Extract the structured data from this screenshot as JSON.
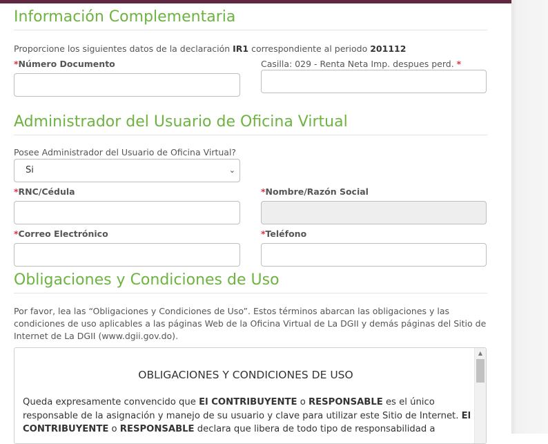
{
  "colors": {
    "accent": "#6cb33f",
    "top_bar": "#5f2742",
    "required": "#d9363e"
  },
  "section1": {
    "title": "Información Complementaria",
    "intro_prefix": "Proporcione los siguientes datos de la declaración ",
    "intro_form": "IR1",
    "intro_middle": " correspondiente al periodo ",
    "intro_period": "201112",
    "numero_documento_label": "Número Documento",
    "casilla_label": "Casilla: 029 - Renta Neta Imp. despues perd. ",
    "required_mark": "*",
    "numero_documento_value": "",
    "casilla_value": ""
  },
  "section2": {
    "title": "Administrador del Usuario de Oficina Virtual",
    "question": "Posee Administrador del Usuario de Oficina Virtual?",
    "select_value": "Si",
    "rnc_label": "RNC/Cédula",
    "nombre_label": "Nombre/Razón Social",
    "correo_label": "Correo Electrónico",
    "telefono_label": "Teléfono",
    "rnc_value": "",
    "nombre_value": "",
    "correo_value": "",
    "telefono_value": ""
  },
  "section3": {
    "title": "Obligaciones y Condiciones de Uso",
    "intro": "Por favor, lea las “Obligaciones y Condiciones de Uso”. Estos términos abarcan las obligaciones y las condiciones de uso aplicables a las páginas Web de la Oficina Virtual de La DGII y demás páginas del Sitio de Internet de La DGII (www.dgii.gov.do).",
    "terms_title": "OBLIGACIONES Y CONDICIONES DE USO",
    "terms_p1": "Queda expresamente convencido que ",
    "terms_b1": "El CONTRIBUYENTE",
    "terms_p2": " o ",
    "terms_b2": "RESPONSABLE",
    "terms_p3": " es el único responsable de la asignación y manejo de su usuario y clave para utilizar este Sitio de Internet. ",
    "terms_b3": "El CONTRIBUYENTE",
    "terms_p4": " o ",
    "terms_b4": "RESPONSABLE",
    "terms_p5": " declara que libera de todo tipo de responsabilidad a"
  }
}
